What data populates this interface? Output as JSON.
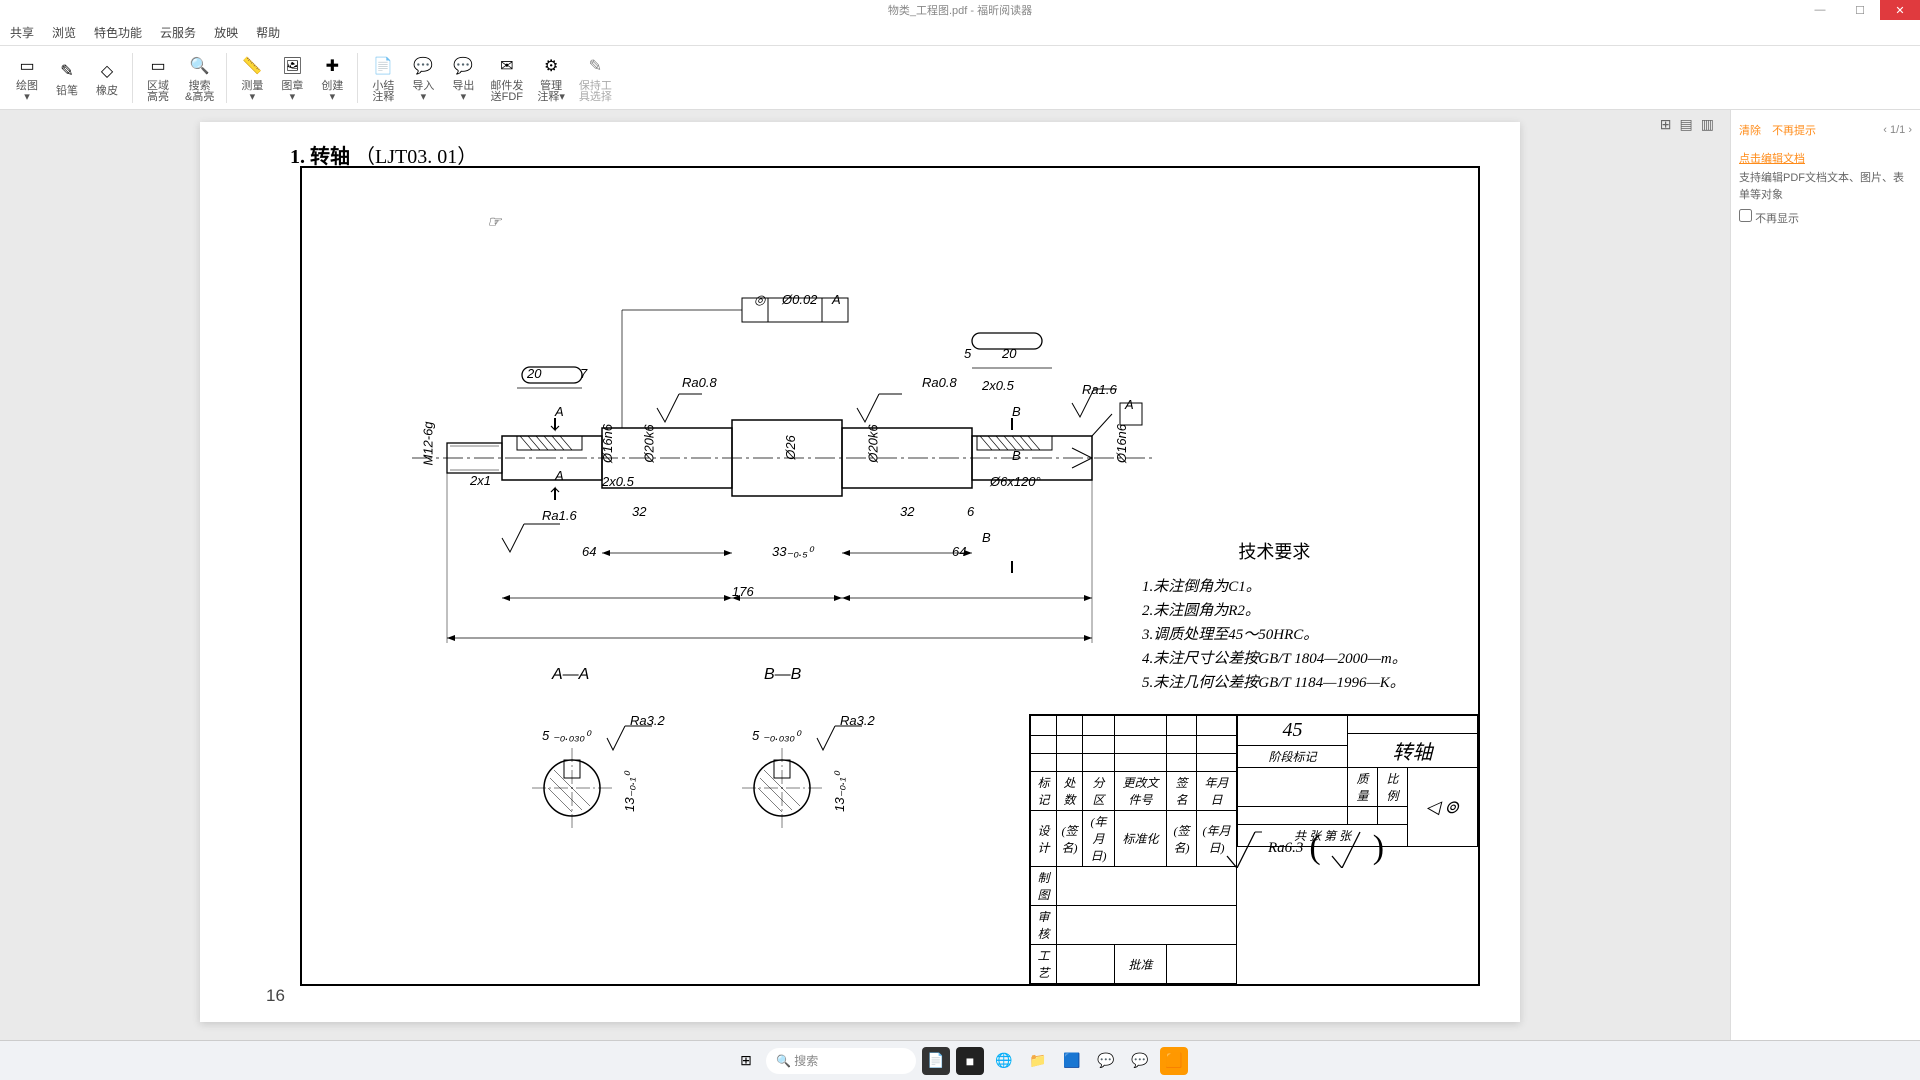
{
  "window": {
    "title": "物类_工程图.pdf - 福昕阅读器",
    "controls": {
      "min": "—",
      "max": "☐",
      "close": "✕"
    }
  },
  "menu": [
    "共享",
    "浏览",
    "特色功能",
    "云服务",
    "放映",
    "帮助"
  ],
  "toolbar": [
    {
      "icon": "▭",
      "label": "绘图\n▾"
    },
    {
      "icon": "✎",
      "label": "铅笔"
    },
    {
      "icon": "◇",
      "label": "橡皮"
    },
    {
      "sep": true
    },
    {
      "icon": "▭",
      "label": "区域\n高亮"
    },
    {
      "icon": "🔍",
      "label": "搜索\n&高亮"
    },
    {
      "sep": true
    },
    {
      "icon": "📏",
      "label": "测量\n▾"
    },
    {
      "icon": "🖼",
      "label": "图章\n▾"
    },
    {
      "icon": "✚",
      "label": "创建\n▾"
    },
    {
      "sep": true
    },
    {
      "icon": "📄",
      "label": "小结\n注释"
    },
    {
      "icon": "💬",
      "label": "导入\n▾"
    },
    {
      "icon": "💬",
      "label": "导出\n▾"
    },
    {
      "icon": "✉",
      "label": "邮件发\n送FDF"
    },
    {
      "icon": "⚙",
      "label": "管理\n注释▾"
    },
    {
      "icon": "✎",
      "label": "保持工\n具选择"
    }
  ],
  "viewer": {
    "view_icons": [
      "⊞",
      "▤",
      "▥"
    ],
    "page_title_num": "1.",
    "page_title_name": "转轴",
    "page_title_code": "（LJT03. 01）",
    "page_number": "16",
    "cursor": "☞"
  },
  "drawing": {
    "geom_tol": {
      "sym": "◎",
      "val": "Ø0.02",
      "ref": "A"
    },
    "datum_a": "A",
    "datum_b": "B",
    "dims": {
      "d20_l": "20",
      "d7": "7",
      "d5": "5",
      "d20_r": "20",
      "d2x1": "2x1",
      "d2x05l": "2x0.5",
      "d2x05r": "2x0.5",
      "d32l": "32",
      "d32r": "32",
      "d6": "6",
      "d64l": "64",
      "d64r": "64",
      "d33": "33₋₀.₅⁰",
      "d176": "176",
      "dia16n6": "Ø16n6",
      "dia20k6": "Ø20k6",
      "dia26": "Ø26",
      "dia20k6r": "Ø20k6",
      "dia16n6r": "Ø16n6",
      "thread": "M12-6g",
      "hole": "Ø6x120°",
      "ra08l": "Ra0.8",
      "ra08r": "Ra0.8",
      "ra16l": "Ra1.6",
      "ra16r": "Ra1.6",
      "sectA": "A",
      "sectB": "B"
    },
    "sections": {
      "aa": "A—A",
      "bb": "B—B",
      "ra32": "Ra3.2",
      "tol5": "5 ₋₀.₀₃₀⁰",
      "tol13": "13₋₀.₁⁰"
    },
    "tech_req": {
      "title": "技术要求",
      "items": [
        "1.未注倒角为C1。",
        "2.未注圆角为R2。",
        "3.调质处理至45～50HRC。",
        "4.未注尺寸公差按GB/T 1804—2000—m。",
        "5.未注几何公差按GB/T 1184—1996—K。"
      ]
    },
    "surface_default": "Ra6.3",
    "title_block": {
      "headers": [
        "标记",
        "处数",
        "分区",
        "更改文件号",
        "签名",
        "年月日"
      ],
      "rows": [
        [
          "设计",
          "(签名)",
          "(年月日)",
          "标准化",
          "(签名)",
          "(年月日)"
        ],
        [
          "制图",
          "",
          "",
          "",
          "",
          ""
        ],
        [
          "审核",
          "",
          "",
          "",
          "",
          ""
        ],
        [
          "工艺",
          "",
          "",
          "批准",
          "",
          ""
        ]
      ],
      "right": {
        "material": "45",
        "name": "转轴",
        "stage": "阶段标记",
        "mass": "质量",
        "scale": "比例",
        "sheets": "共  张    第  张"
      }
    }
  },
  "panel": {
    "clear": "清除",
    "dismiss": "不再提示",
    "page": "1/1",
    "link": "点击编辑文档",
    "desc": "支持编辑PDF文档文本、图片、表单等对象",
    "chk": "不再显示"
  },
  "taskbar": {
    "search_ph": "搜索",
    "icons": [
      "⊞",
      "🔍",
      "📄",
      "■",
      "🌐",
      "📁",
      "🟦",
      "💬",
      "💬",
      "🟧"
    ]
  }
}
